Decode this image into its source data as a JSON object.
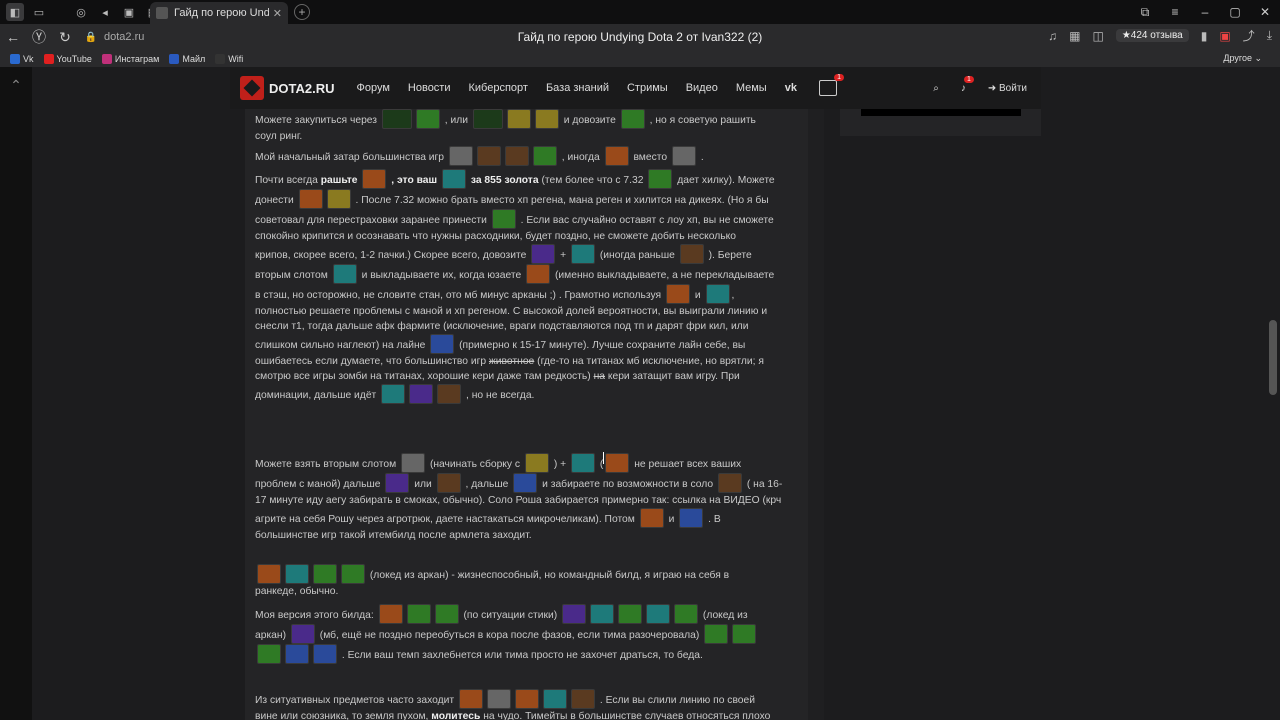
{
  "browser": {
    "active_tab": "Гайд по герою Undying Dota 2 от Ivan322 (2)",
    "url": "dota2.ru",
    "page_title": "Гайд по герою Undying Dota 2 от Ivan322 (2)",
    "reviews": "★424 отзыва",
    "bookmarks": [
      "Vk",
      "YouTube",
      "Инстаграм",
      "Майл",
      "Wifi"
    ],
    "other": "Другое ⌄"
  },
  "site": {
    "logo": "DOTA2.RU",
    "menu": [
      "Форум",
      "Новости",
      "Киберспорт",
      "База знаний",
      "Стримы",
      "Видео",
      "Мемы"
    ],
    "gift_badge": "1",
    "notif_badge": "1",
    "login": "Войти"
  },
  "article": {
    "p1a": "Можете закупиться через",
    "p1b": ", или",
    "p1c": "и довозите",
    "p1d": ", но я советую рашить",
    "p1e": "соул ринг.",
    "p2a": "Мой начальный затар большинства игр",
    "p2b": ", иногда",
    "p2c": "вместо",
    "p3a": "Почти всегда ",
    "p3b": "рашьте",
    "p3c": ", это ваш",
    "p3d": "за 855 золота",
    "p3e": " (тем более что с 7.32",
    "p3f": "дает хилку). Можете",
    "p3g": "донести",
    "p3h": ". После 7.32 можно брать вместо хп регена, мана реген и хилится на дикеях. (Но я бы",
    "p3i": "советовал для перестраховки заранее принести",
    "p3j": ". Если вас случайно оставят с лоу хп, вы не сможете",
    "p3k": "спокойно крипится и осознавать что нужны расходники, будет поздно, не сможете добить несколько",
    "p3l": "крипов, скорее всего, 1-2 пачки.) Скорее всего, довозите",
    "p3m": "+",
    "p3n": "(иногда раньше",
    "p3o": "). Берете",
    "p3p": "вторым слотом",
    "p3q": "и выкладываете их, когда юзаете",
    "p3r": "(именно выкладываете, а не перекладываете",
    "p3s": "в стэш, но осторожно, не словите стан, ото мб минус арканы ;) . Грамотно используя",
    "p3t": "и",
    "p3u": ",",
    "p3v": "полностью решаете проблемы с маной и хп регеном. С высокой долей вероятности, вы выиграли линию и",
    "p3w": "снесли т1, тогда дальше афк фармите (исключение, враги подставляются под тп и дарят фри кил, или",
    "p3x": "слишком сильно наглеют) на лайне",
    "p3y": "(примерно к 15-17 минуте). Лучше сохраните лайн себе, вы",
    "p3z": "ошибаетесь если думаете, что большинство игр ",
    "p3z1": "животное",
    "p3z2": " (где-то на титанах мб исключение, но врятли; я",
    "p3z3": "смотрю все игры зомби на титанах, хорошие кери даже там редкость) ",
    "p3z4": "на",
    "p3z5": " кери затащит вам игру. При",
    "p3z6": "доминации, дальше идёт",
    "p3z7": ", но не всегда.",
    "p4a": "Можете взять вторым слотом",
    "p4b": "(начинать сборку с",
    "p4c": ") +",
    "p4d": "(",
    "p4e": "не решает всех ваших",
    "p4f": "проблем с маной) дальше",
    "p4g": "или",
    "p4h": ", дальше",
    "p4i": "и забираете по возможности в соло",
    "p4j": "( на 16-",
    "p4k": "17 минуте иду аегу забирать в смоках, обычно). Соло Роша забирается примерно так: ссылка на ВИДЕО (крч",
    "p4l": "агрите на себя Рошу через агротрюк, даете настакаться микрочеликам). Потом",
    "p4m": "и",
    "p4n": ". В",
    "p4o": "большинстве игр такой итембилд после армлета заходит.",
    "p5a": "(локед из аркан) - жизнеспособный, но командный билд, я играю на себя в",
    "p5b": "ранкеде, обычно.",
    "p6a": "Моя версия этого билда:",
    "p6b": "(по ситуации стики)",
    "p6c": "(локед из",
    "p6d": "аркан)",
    "p6e": "(мб, ещё не поздно переобуться в кора после фазов, если тима разочеровала)",
    "p6f": ". Если ваш темп захлебнется или тима просто не захочет драться, то беда.",
    "p7a": "Из ситуативных предметов часто заходит",
    "p7b": ". Если вы слили линию по своей",
    "p7c": "вине или союзника, то земля пухом, ",
    "p7d": "молитесь",
    "p7e": " на чудо. Тимейты в большинстве случаев относяться плохо"
  },
  "icon_colors": {
    "green": "#2f7a25",
    "teal": "#1e7a7a",
    "orange": "#9a4a1a",
    "purple": "#4a2a8a",
    "grey": "#666666",
    "gold": "#8a7a20",
    "brown": "#5a3a20",
    "blue": "#2a4a9a"
  }
}
